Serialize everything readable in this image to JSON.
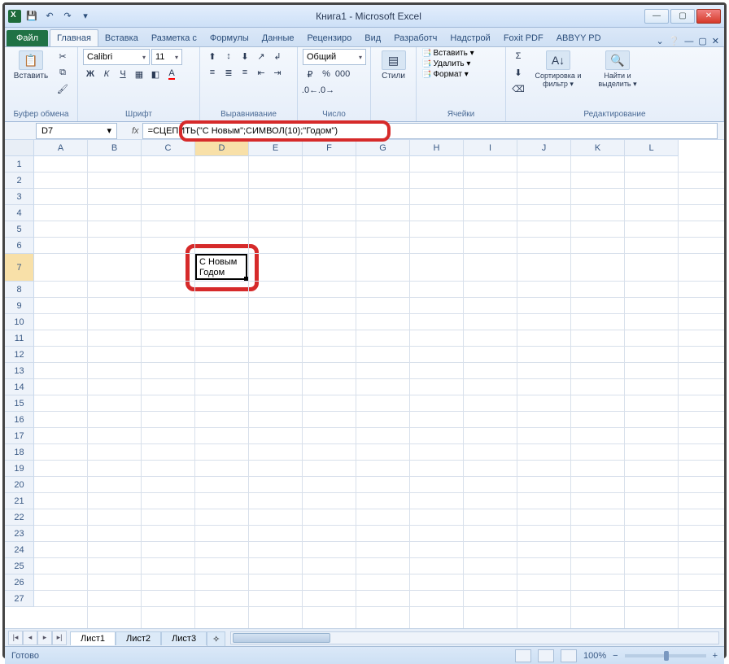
{
  "window": {
    "title": "Книга1 - Microsoft Excel"
  },
  "qat": {
    "save_tip": "💾",
    "undo_tip": "↶",
    "redo_tip": "↷",
    "dd_tip": "▾"
  },
  "tabs": {
    "file": "Файл",
    "home": "Главная",
    "insert": "Вставка",
    "layout": "Разметка с",
    "formulas": "Формулы",
    "data": "Данные",
    "review": "Рецензиро",
    "view": "Вид",
    "developer": "Разработч",
    "addins": "Надстрой",
    "foxit": "Foxit PDF",
    "abbyy": "ABBYY PD"
  },
  "ribbon": {
    "clipboard": {
      "paste": "Вставить",
      "label": "Буфер обмена"
    },
    "font": {
      "name": "Calibri",
      "size": "11",
      "label": "Шрифт"
    },
    "alignment": {
      "label": "Выравнивание"
    },
    "number": {
      "format": "Общий",
      "label": "Число"
    },
    "styles": {
      "btn": "Стили",
      "label": ""
    },
    "cells": {
      "insert": "Вставить ▾",
      "delete": "Удалить ▾",
      "format": "Формат ▾",
      "label": "Ячейки"
    },
    "editing": {
      "sort": "Сортировка и фильтр ▾",
      "find": "Найти и выделить ▾",
      "label": "Редактирование"
    }
  },
  "namebox": {
    "value": "D7"
  },
  "formula": {
    "value": "=СЦЕПИТЬ(\"С Новым\";СИМВОЛ(10);\"Годом\")"
  },
  "columns": [
    "A",
    "B",
    "C",
    "D",
    "E",
    "F",
    "G",
    "H",
    "I",
    "J",
    "K",
    "L"
  ],
  "rows": [
    "1",
    "2",
    "3",
    "4",
    "5",
    "6",
    "7",
    "8",
    "9",
    "10",
    "11",
    "12",
    "13",
    "14",
    "15",
    "16",
    "17",
    "18",
    "19",
    "20",
    "21",
    "22",
    "23",
    "24",
    "25",
    "26",
    "27"
  ],
  "cell": {
    "address": "D7",
    "line1": "С Новым",
    "line2": "Годом"
  },
  "sheets": {
    "s1": "Лист1",
    "s2": "Лист2",
    "s3": "Лист3"
  },
  "status": {
    "ready": "Готово",
    "zoom": "100%"
  }
}
